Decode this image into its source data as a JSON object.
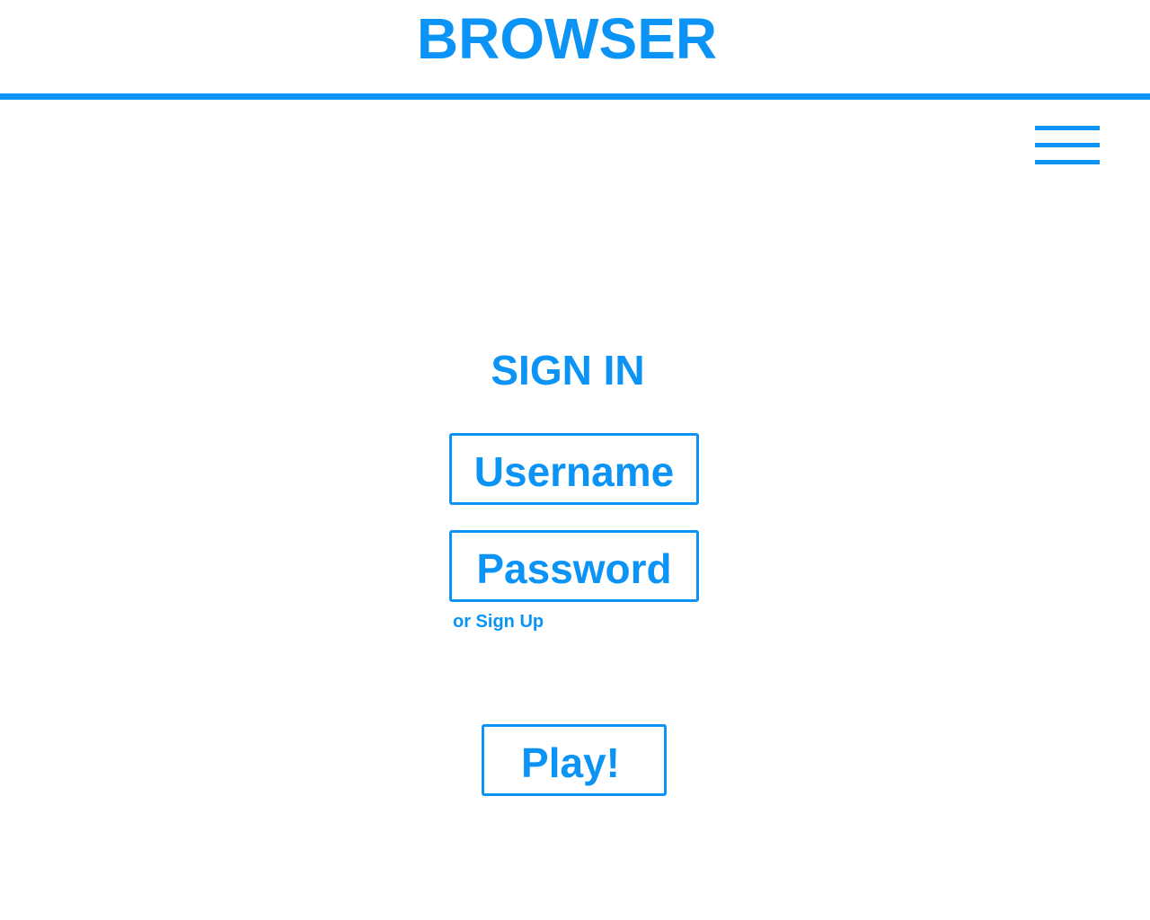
{
  "header": {
    "title": "BROWSER"
  },
  "menu": {
    "icon": "hamburger-menu-icon"
  },
  "signin": {
    "heading": "SIGN IN",
    "username_placeholder": "Username",
    "password_placeholder": "Password",
    "signup_link": "or Sign Up",
    "play_label": "Play!"
  },
  "colors": {
    "accent": "#0b93f6",
    "background": "#ffffff"
  }
}
